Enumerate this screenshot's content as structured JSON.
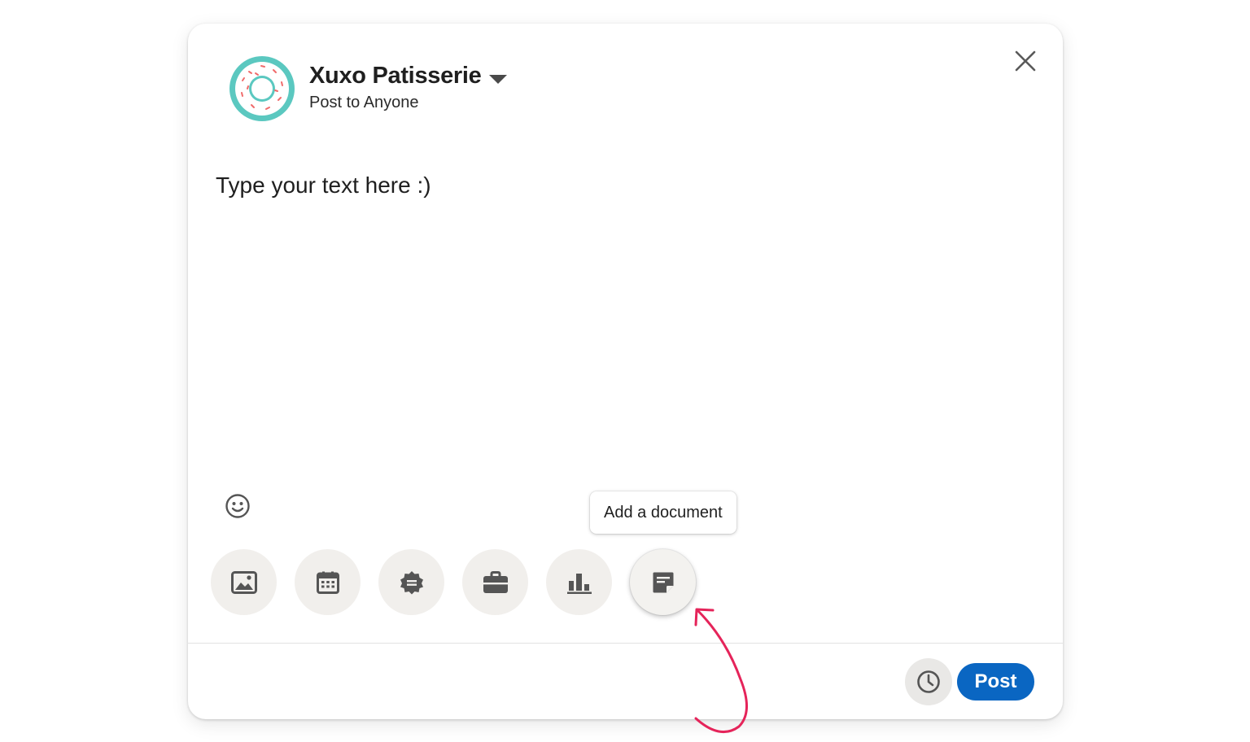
{
  "account": {
    "name": "Xuxo Patisserie",
    "visibility": "Post to Anyone"
  },
  "editor": {
    "text": "Type your text here :)"
  },
  "toolbar": {
    "items": [
      {
        "icon": "photo-icon"
      },
      {
        "icon": "calendar-icon"
      },
      {
        "icon": "badge-icon"
      },
      {
        "icon": "briefcase-icon"
      },
      {
        "icon": "poll-icon"
      },
      {
        "icon": "document-icon",
        "active": true
      }
    ],
    "tooltip": "Add a document"
  },
  "footer": {
    "post_label": "Post",
    "schedule_icon": "clock-icon"
  },
  "colors": {
    "accent": "#0a66c2",
    "avatar_ring": "#5bc8c0",
    "sprinkles": "#f06b6b",
    "annotation": "#e5245a",
    "button_bg": "#f1efec"
  }
}
